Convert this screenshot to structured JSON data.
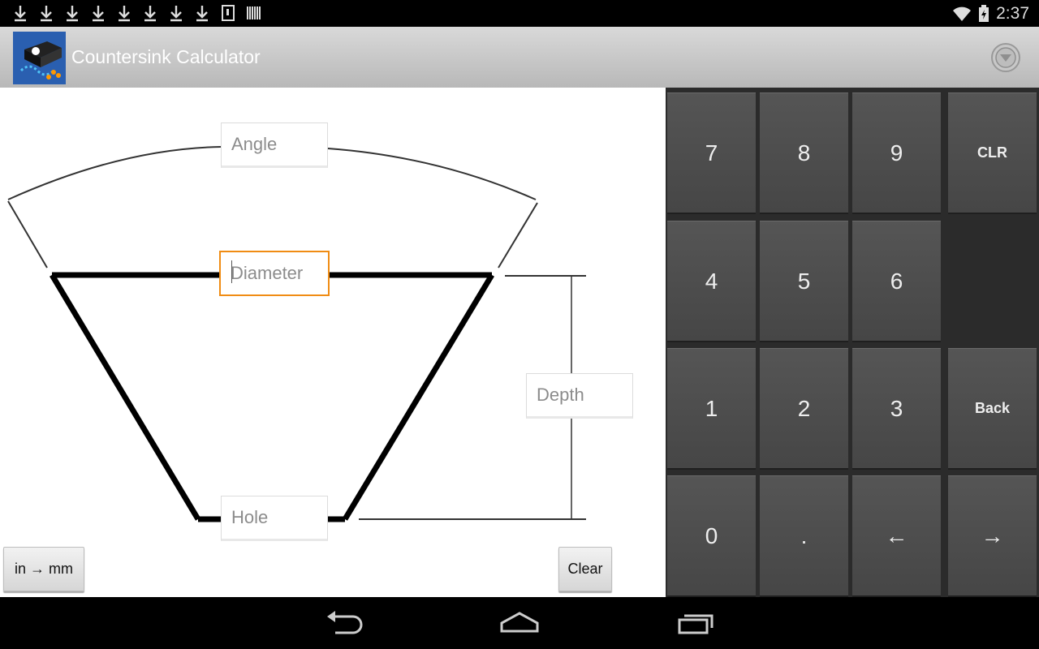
{
  "status_bar": {
    "time": "2:37",
    "notification_icons": [
      "download-icon",
      "download-icon",
      "download-icon",
      "download-icon",
      "download-icon",
      "download-icon",
      "download-icon",
      "download-icon",
      "sd-card-icon",
      "barcode-icon"
    ],
    "wifi_icon": "wifi-icon",
    "battery_icon": "battery-charging-icon"
  },
  "action_bar": {
    "title": "Countersink Calculator",
    "app_icon": "countersink-app-icon",
    "overflow_icon": "overflow-menu-icon"
  },
  "diagram": {
    "fields": {
      "angle": {
        "placeholder": "Angle",
        "value": ""
      },
      "diameter": {
        "placeholder": "Diameter",
        "value": ""
      },
      "depth": {
        "placeholder": "Depth",
        "value": ""
      },
      "hole": {
        "placeholder": "Hole",
        "value": ""
      }
    },
    "convert_button": "in → mm",
    "clear_button": "Clear"
  },
  "keypad": {
    "rows": [
      [
        "7",
        "8",
        "9",
        "CLR"
      ],
      [
        "4",
        "5",
        "6",
        ""
      ],
      [
        "1",
        "2",
        "3",
        "Back"
      ],
      [
        "0",
        ".",
        "←",
        "→"
      ]
    ]
  },
  "nav_bar": {
    "back_icon": "back-icon",
    "home_icon": "home-icon",
    "recents_icon": "recent-apps-icon"
  }
}
